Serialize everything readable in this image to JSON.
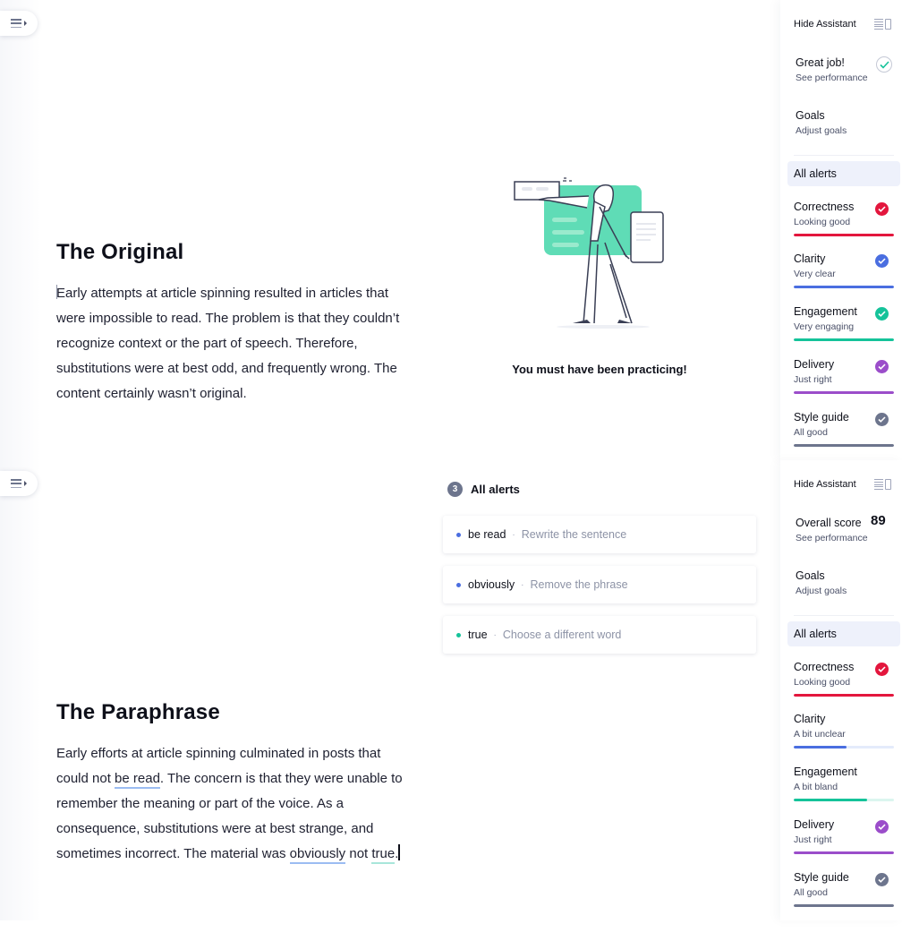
{
  "colors": {
    "correctness": "#e3163d",
    "clarity": "#4a6ee0",
    "engagement": "#15c39a",
    "delivery": "#9b4dca",
    "style_guide": "#6d758d",
    "clarity_track": "#e4ebfb",
    "engagement_track": "#dbf6ef"
  },
  "top": {
    "doc": {
      "title": "The Original",
      "body": "Early attempts at article spinning resulted in articles that were impossible to read. The problem is that they couldn’t recognize context or the part of speech. Therefore, substitutions were at best odd, and frequently wrong. The content certainly wasn’t original."
    },
    "illustration": {
      "icon": "woman-presenting-illustration",
      "caption": "You must have been practicing!"
    },
    "sidebar": {
      "hide_label": "Hide Assistant",
      "score": {
        "title": "Great job!",
        "sub": "See performance"
      },
      "goals": {
        "title": "Goals",
        "sub": "Adjust goals"
      },
      "all_alerts": "All alerts",
      "categories": [
        {
          "title": "Correctness",
          "sub": "Looking good",
          "progress": 1.0,
          "checked": true
        },
        {
          "title": "Clarity",
          "sub": "Very clear",
          "progress": 1.0,
          "checked": true
        },
        {
          "title": "Engagement",
          "sub": "Very engaging",
          "progress": 1.0,
          "checked": true
        },
        {
          "title": "Delivery",
          "sub": "Just right",
          "progress": 1.0,
          "checked": true
        },
        {
          "title": "Style guide",
          "sub": "All good",
          "progress": 1.0,
          "checked": true
        }
      ]
    }
  },
  "bottom": {
    "doc": {
      "title": "The Paraphrase",
      "segments": [
        "Early efforts at article spinning culminated in posts that could not ",
        "be read",
        ". The concern is that they were unable to remember the meaning or part of the voice. As a consequence, substitutions were at best strange, and sometimes incorrect. The material was ",
        "obviously",
        " not ",
        "true",
        "."
      ]
    },
    "alerts": {
      "count": "3",
      "label": "All alerts",
      "items": [
        {
          "word": "be read",
          "hint": "Rewrite the sentence",
          "color": "#4a6ee0"
        },
        {
          "word": "obviously",
          "hint": "Remove the phrase",
          "color": "#4a6ee0"
        },
        {
          "word": "true",
          "hint": "Choose a different word",
          "color": "#15c39a"
        }
      ]
    },
    "sidebar": {
      "hide_label": "Hide Assistant",
      "score": {
        "title": "Overall score",
        "value": "89",
        "sub": "See performance"
      },
      "goals": {
        "title": "Goals",
        "sub": "Adjust goals"
      },
      "all_alerts": "All alerts",
      "categories": [
        {
          "title": "Correctness",
          "sub": "Looking good",
          "progress": 1.0,
          "checked": true
        },
        {
          "title": "Clarity",
          "sub": "A bit unclear",
          "progress": 0.53,
          "checked": false
        },
        {
          "title": "Engagement",
          "sub": "A bit bland",
          "progress": 0.73,
          "checked": false
        },
        {
          "title": "Delivery",
          "sub": "Just right",
          "progress": 1.0,
          "checked": true
        },
        {
          "title": "Style guide",
          "sub": "All good",
          "progress": 1.0,
          "checked": true
        }
      ]
    }
  }
}
